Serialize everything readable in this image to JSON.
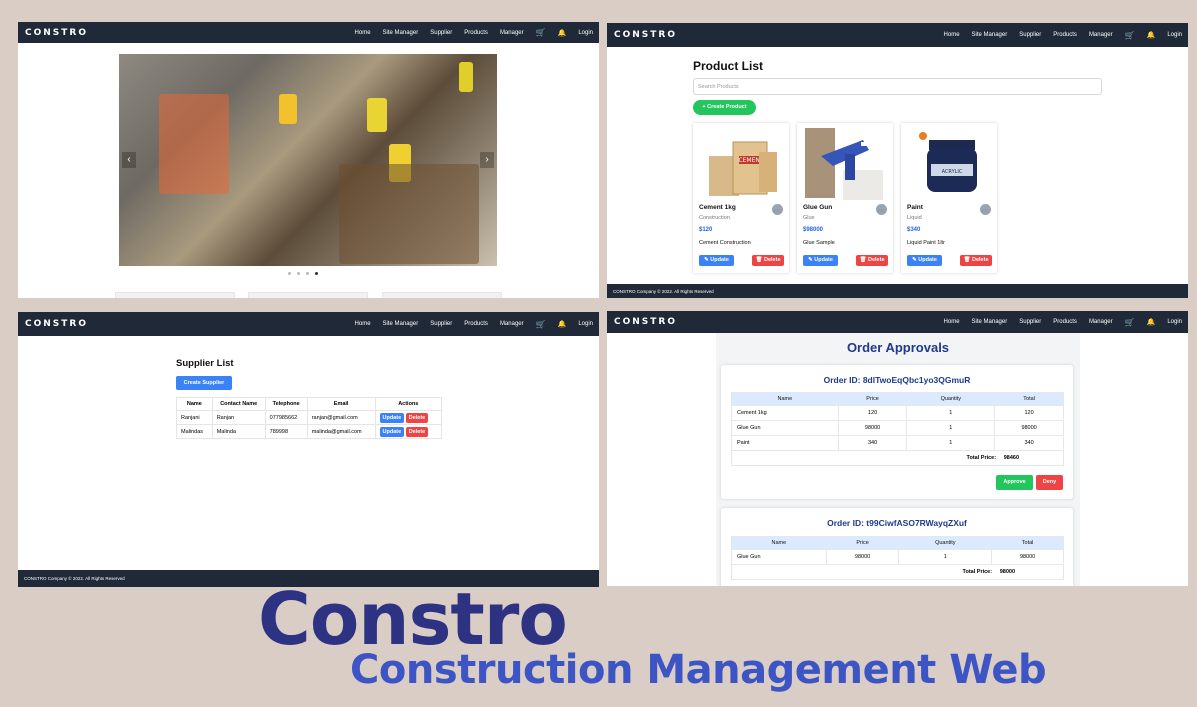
{
  "brand": "CONSTRO",
  "nav": {
    "home": "Home",
    "site_manager": "Site Manager",
    "supplier": "Supplier",
    "products": "Products",
    "manager": "Manager",
    "login": "Login",
    "cart_icon": "cart-icon",
    "bell_icon": "bell-icon"
  },
  "home_page": {
    "carousel_prev": "‹",
    "carousel_next": "›",
    "active_slide": 4,
    "slide_count": 4
  },
  "product_page": {
    "title": "Product List",
    "search_placeholder": "Search Products",
    "create_button": "+ Create Product",
    "update_label": "Update",
    "delete_label": "Delete",
    "products": [
      {
        "name": "Cement 1kg",
        "category": "Construction",
        "price": "$120",
        "description": "Cement Construction"
      },
      {
        "name": "Glue Gun",
        "category": "Glue",
        "price": "$98000",
        "description": "Glue Sample"
      },
      {
        "name": "Paint",
        "category": "Liquid",
        "price": "$340",
        "description": "Liquid Paint 1ltr"
      }
    ],
    "footer": "CONSTRO Company © 2022. All Rights Reserved"
  },
  "supplier_page": {
    "title": "Supplier List",
    "create_button": "Create Supplier",
    "columns": [
      "Name",
      "Contact Name",
      "Telephone",
      "Email",
      "Actions"
    ],
    "rows": [
      {
        "name": "Ranjani",
        "contact": "Ranjan",
        "telephone": "077985662",
        "email": "ranjan@gmail.com"
      },
      {
        "name": "Malindas",
        "contact": "Malinda",
        "telephone": "789998",
        "email": "malinda@gmail.com"
      }
    ],
    "update_label": "Update",
    "delete_label": "Delete",
    "footer": "CONSTRO Company © 2022. All Rights Reserved"
  },
  "orders_page": {
    "title": "Order Approvals",
    "columns": [
      "Name",
      "Price",
      "Quantity",
      "Total"
    ],
    "total_price_label": "Total Price:",
    "approve_label": "Approve",
    "deny_label": "Deny",
    "orders": [
      {
        "id_label": "Order ID: 8dlTwoEqQbc1yo3QGmuR",
        "items": [
          {
            "name": "Cement 1kg",
            "price": "120",
            "quantity": "1",
            "total": "120"
          },
          {
            "name": "Glue Gun",
            "price": "98000",
            "quantity": "1",
            "total": "98000"
          },
          {
            "name": "Paint",
            "price": "340",
            "quantity": "1",
            "total": "340"
          }
        ],
        "total_price": "98460"
      },
      {
        "id_label": "Order ID: t99CiwfASO7RWayqZXuf",
        "items": [
          {
            "name": "Glue Gun",
            "price": "98000",
            "quantity": "1",
            "total": "98000"
          }
        ],
        "total_price": "98000"
      }
    ]
  },
  "caption": {
    "title": "Constro",
    "subtitle": "Construction Management Web"
  },
  "colors": {
    "navbar": "#1f2937",
    "background": "#d9cdc5",
    "title": "#2d3382",
    "subtitle": "#3d54c4",
    "green": "#22c55e",
    "blue": "#3b82f6",
    "red": "#ef4444"
  }
}
